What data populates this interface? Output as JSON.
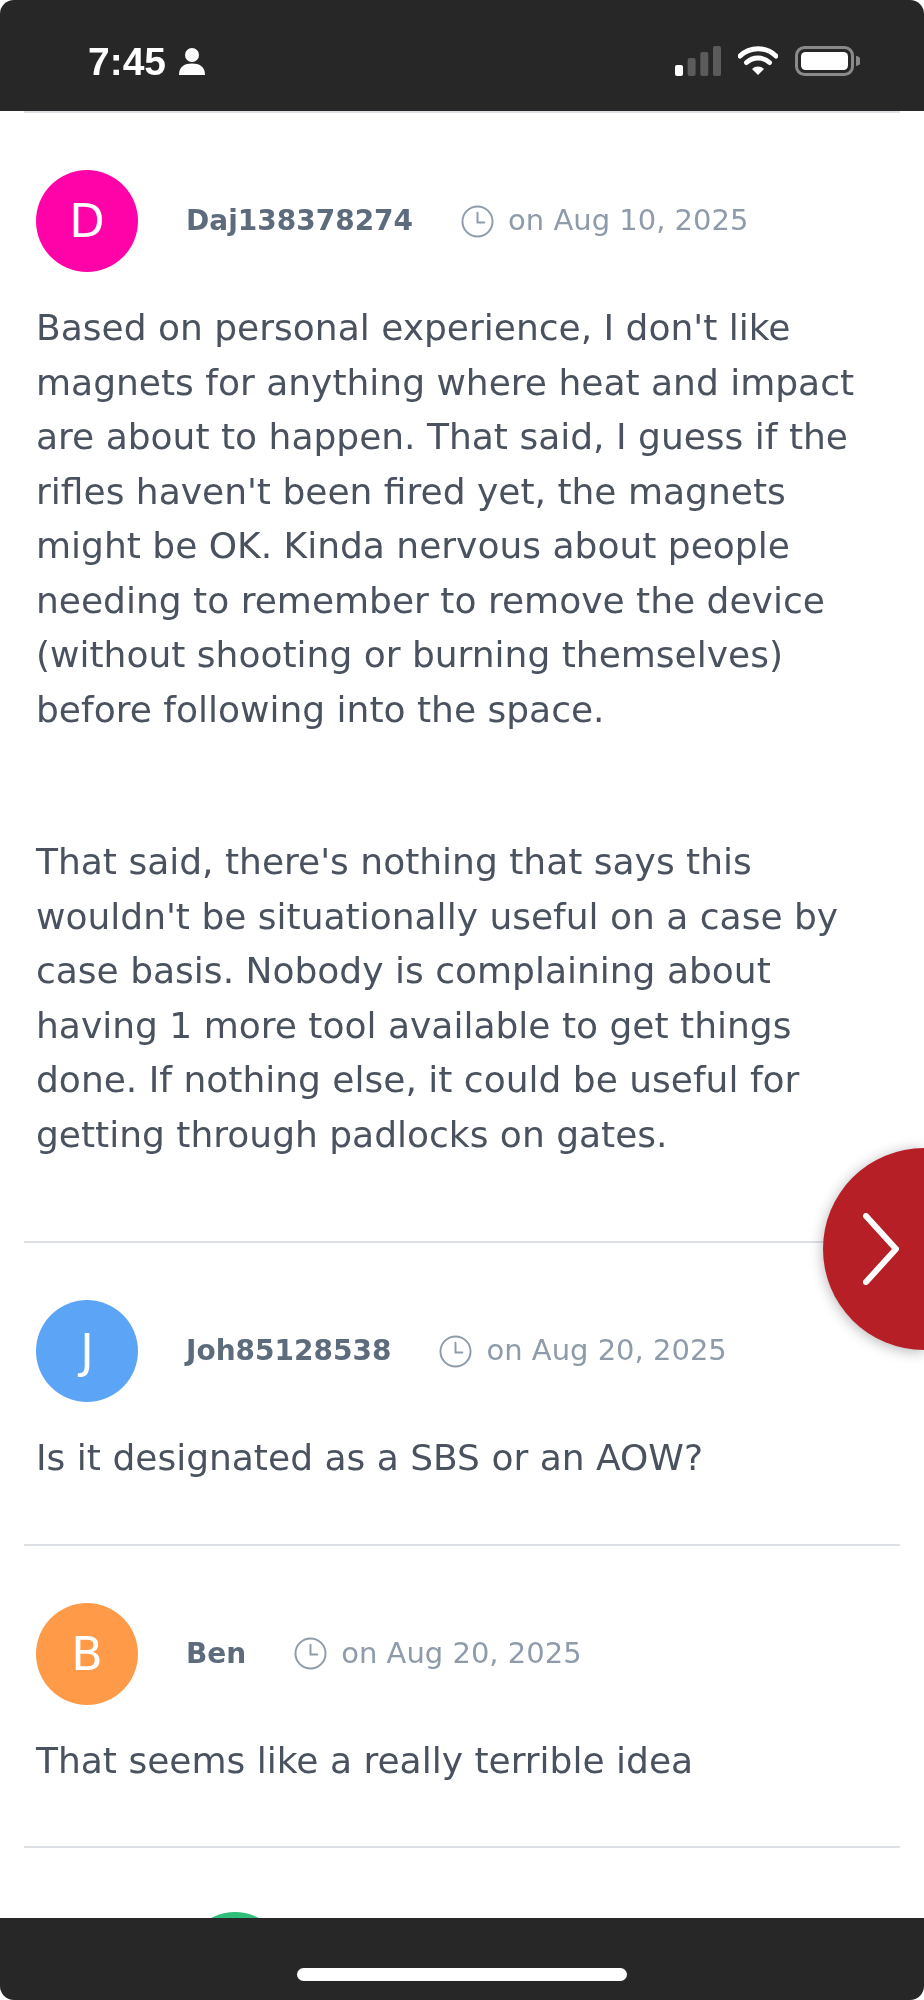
{
  "status_bar": {
    "time": "7:45"
  },
  "comments": [
    {
      "avatar_letter": "D",
      "color": "#ff03a8",
      "author": "Daj138378274",
      "date": "on Aug 10, 2025",
      "body": [
        "Based on personal experience, I don't like magnets for anything where heat and impact are about to happen. That said, I guess if the rifles haven't been fired yet, the magnets might be OK. Kinda nervous about people needing to remember to remove the device (without shooting or burning themselves) before following into the space.",
        "That said, there's nothing that says this wouldn't be situationally useful on a case by case basis. Nobody is complaining about having 1 more tool available to get things done. If nothing else, it could be useful for getting through padlocks on gates."
      ]
    },
    {
      "avatar_letter": "J",
      "color": "#5ca4f6",
      "author": "Joh85128538",
      "date": "on Aug 20, 2025",
      "body": [
        "Is it designated as a SBS or an AOW?"
      ]
    },
    {
      "avatar_letter": "B",
      "color": "#ff9a48",
      "author": "Ben",
      "date": "on Aug 20, 2025",
      "body": [
        "That seems like a really terrible idea"
      ],
      "children": [
        {
          "color": "#2fbd7a"
        }
      ]
    }
  ]
}
